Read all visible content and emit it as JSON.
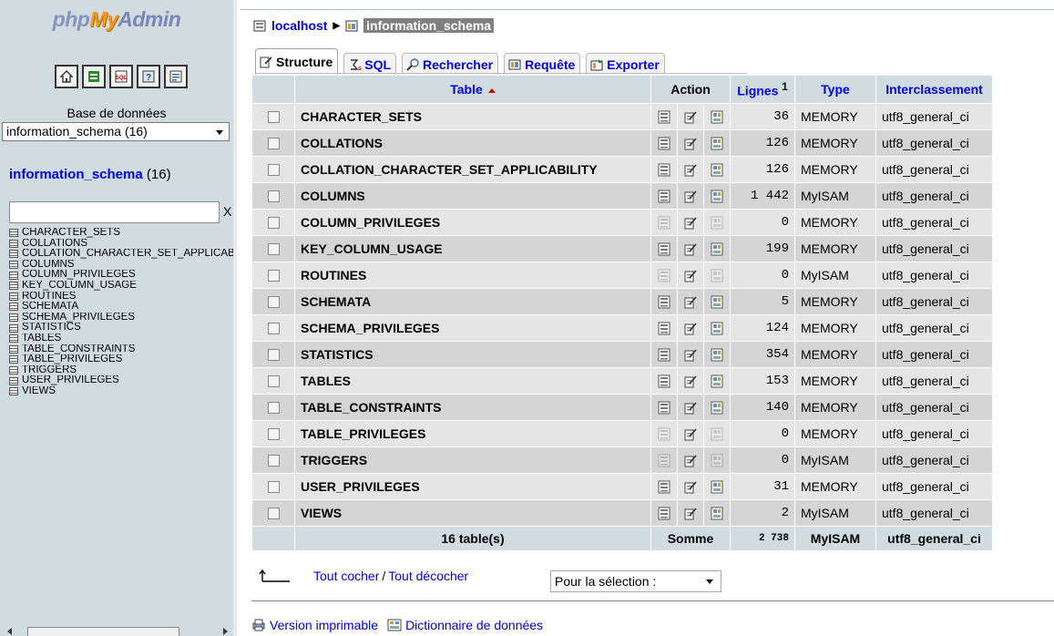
{
  "sidebar": {
    "logo": {
      "part1": "php",
      "part2": "My",
      "part3": "Admin"
    },
    "quick_icons": [
      "home-icon",
      "exit-icon",
      "sql-query-icon",
      "help-icon",
      "docs-icon"
    ],
    "db_label": "Base de données",
    "db_select_value": "information_schema (16)",
    "db_link": "information_schema",
    "db_count": "(16)",
    "filter_clear": "X",
    "tables": [
      "CHARACTER_SETS",
      "COLLATIONS",
      "COLLATION_CHARACTER_SET_APPLICABILITY",
      "COLUMNS",
      "COLUMN_PRIVILEGES",
      "KEY_COLUMN_USAGE",
      "ROUTINES",
      "SCHEMATA",
      "SCHEMA_PRIVILEGES",
      "STATISTICS",
      "TABLES",
      "TABLE_CONSTRAINTS",
      "TABLE_PRIVILEGES",
      "TRIGGERS",
      "USER_PRIVILEGES",
      "VIEWS"
    ]
  },
  "breadcrumb": {
    "server": "localhost",
    "database": "information_schema"
  },
  "tabs": [
    {
      "label": "Structure",
      "icon": "structure-icon",
      "active": true
    },
    {
      "label": "SQL",
      "icon": "sql-icon",
      "active": false
    },
    {
      "label": "Rechercher",
      "icon": "search-icon",
      "active": false
    },
    {
      "label": "Requête",
      "icon": "query-icon",
      "active": false
    },
    {
      "label": "Exporter",
      "icon": "export-icon",
      "active": false
    }
  ],
  "table": {
    "headers": {
      "table": "Table",
      "action": "Action",
      "rows": "Lignes",
      "rows_sup": "1",
      "type": "Type",
      "collation": "Interclassement"
    },
    "rows": [
      {
        "name": "CHARACTER_SETS",
        "rows": "36",
        "type": "MEMORY",
        "collation": "utf8_general_ci",
        "browse_enabled": true
      },
      {
        "name": "COLLATIONS",
        "rows": "126",
        "type": "MEMORY",
        "collation": "utf8_general_ci",
        "browse_enabled": true
      },
      {
        "name": "COLLATION_CHARACTER_SET_APPLICABILITY",
        "rows": "126",
        "type": "MEMORY",
        "collation": "utf8_general_ci",
        "browse_enabled": true
      },
      {
        "name": "COLUMNS",
        "rows": "1 442",
        "type": "MyISAM",
        "collation": "utf8_general_ci",
        "browse_enabled": true
      },
      {
        "name": "COLUMN_PRIVILEGES",
        "rows": "0",
        "type": "MEMORY",
        "collation": "utf8_general_ci",
        "browse_enabled": false
      },
      {
        "name": "KEY_COLUMN_USAGE",
        "rows": "199",
        "type": "MEMORY",
        "collation": "utf8_general_ci",
        "browse_enabled": true
      },
      {
        "name": "ROUTINES",
        "rows": "0",
        "type": "MyISAM",
        "collation": "utf8_general_ci",
        "browse_enabled": false
      },
      {
        "name": "SCHEMATA",
        "rows": "5",
        "type": "MEMORY",
        "collation": "utf8_general_ci",
        "browse_enabled": true
      },
      {
        "name": "SCHEMA_PRIVILEGES",
        "rows": "124",
        "type": "MEMORY",
        "collation": "utf8_general_ci",
        "browse_enabled": true
      },
      {
        "name": "STATISTICS",
        "rows": "354",
        "type": "MEMORY",
        "collation": "utf8_general_ci",
        "browse_enabled": true
      },
      {
        "name": "TABLES",
        "rows": "153",
        "type": "MEMORY",
        "collation": "utf8_general_ci",
        "browse_enabled": true
      },
      {
        "name": "TABLE_CONSTRAINTS",
        "rows": "140",
        "type": "MEMORY",
        "collation": "utf8_general_ci",
        "browse_enabled": true
      },
      {
        "name": "TABLE_PRIVILEGES",
        "rows": "0",
        "type": "MEMORY",
        "collation": "utf8_general_ci",
        "browse_enabled": false
      },
      {
        "name": "TRIGGERS",
        "rows": "0",
        "type": "MyISAM",
        "collation": "utf8_general_ci",
        "browse_enabled": false
      },
      {
        "name": "USER_PRIVILEGES",
        "rows": "31",
        "type": "MEMORY",
        "collation": "utf8_general_ci",
        "browse_enabled": true
      },
      {
        "name": "VIEWS",
        "rows": "2",
        "type": "MyISAM",
        "collation": "utf8_general_ci",
        "browse_enabled": true
      }
    ],
    "footer": {
      "count": "16 table(s)",
      "sum_label": "Somme",
      "total_rows": "2 738",
      "type": "MyISAM",
      "collation": "utf8_general_ci"
    }
  },
  "selection": {
    "check_all": "Tout cocher",
    "separator": "/",
    "uncheck_all": "Tout décocher",
    "with_selected": "Pour la sélection :"
  },
  "bottom": {
    "print_view": "Version imprimable",
    "data_dictionary": "Dictionnaire de données"
  }
}
